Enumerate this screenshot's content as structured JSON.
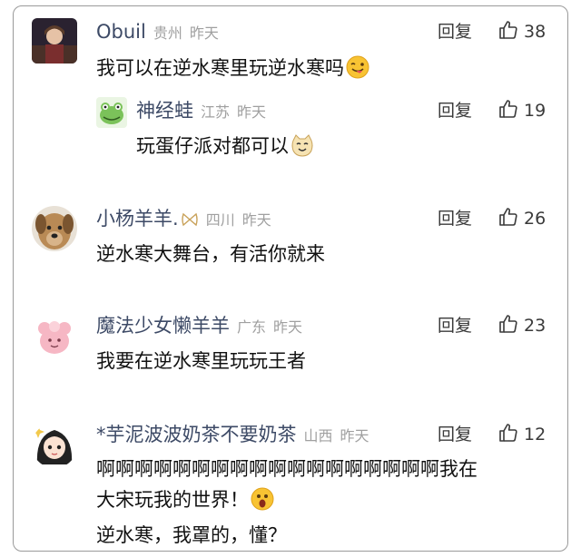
{
  "comments": [
    {
      "user": "Obuil",
      "location": "贵州",
      "time": "昨天",
      "reply_label": "回复",
      "likes": "38",
      "lines": [
        "我可以在逆水寒里玩逆水寒吗"
      ],
      "emoji": "tongue-wink-emoji",
      "replies": [
        {
          "user": "神经蛙",
          "location": "江苏",
          "time": "昨天",
          "reply_label": "回复",
          "likes": "19",
          "lines": [
            "玩蛋仔派对都可以"
          ],
          "emoji": "cat-face-emoji"
        }
      ]
    },
    {
      "user": "小杨羊羊.",
      "location": "四川",
      "time": "昨天",
      "reply_label": "回复",
      "likes": "26",
      "lines": [
        "逆水寒大舞台，有活你就来"
      ]
    },
    {
      "user": "魔法少女懒羊羊",
      "location": "广东",
      "time": "昨天",
      "reply_label": "回复",
      "likes": "23",
      "lines": [
        "我要在逆水寒里玩玩王者"
      ]
    },
    {
      "user": "*芋泥波波奶茶不要奶茶",
      "location": "山西",
      "time": "昨天",
      "reply_label": "回复",
      "likes": "12",
      "lines": [
        "啊啊啊啊啊啊啊啊啊啊啊啊啊啊啊啊啊啊我在",
        "大宋玩我的世界！",
        "逆水寒，我罩的，懂？"
      ],
      "emoji": "surprised-face-emoji"
    }
  ],
  "colors": {
    "username": "#3d4a66",
    "meta": "#a0a0a0",
    "text": "#111111"
  }
}
